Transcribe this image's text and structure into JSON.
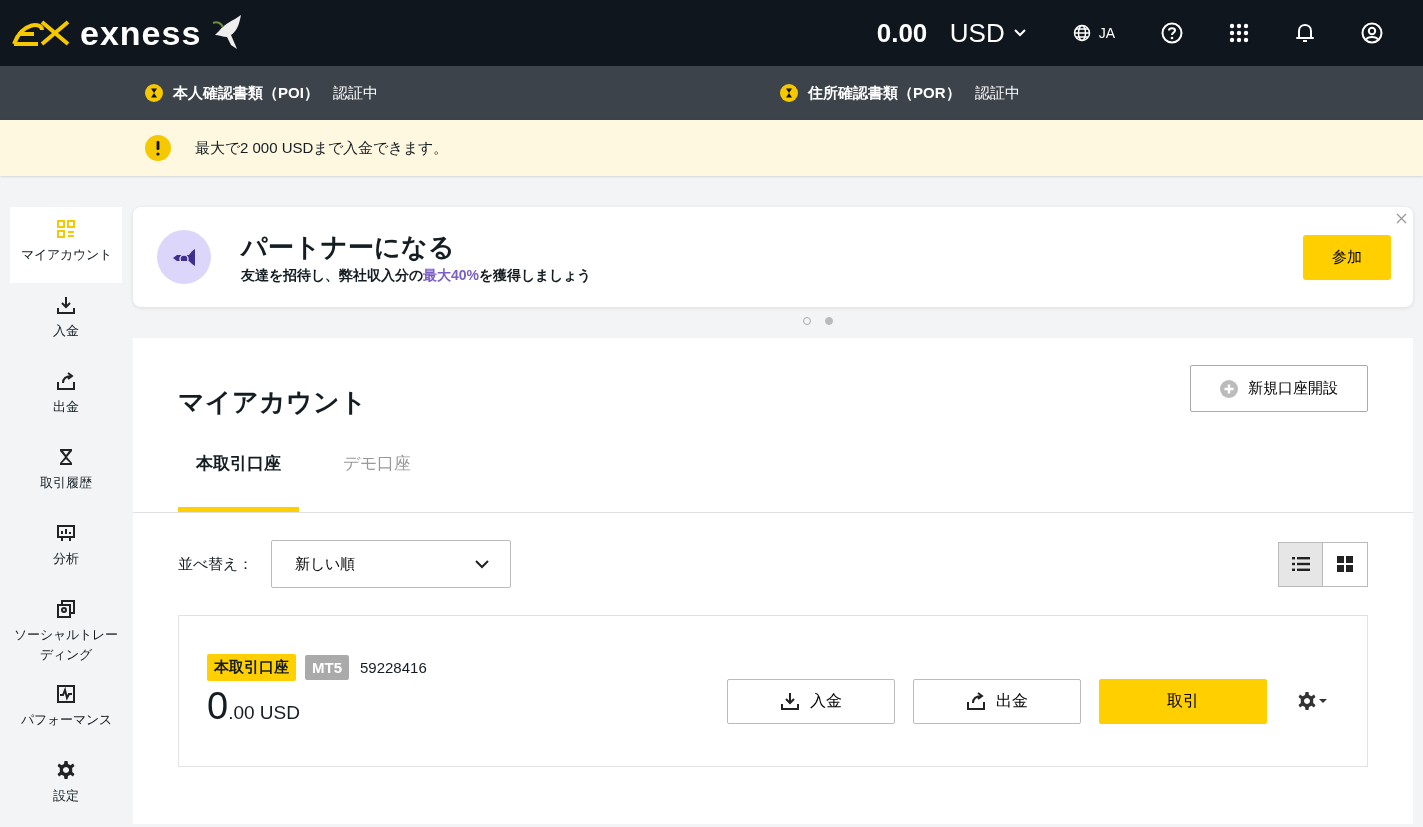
{
  "header": {
    "logo": "exness",
    "balance": "0.00",
    "currency": "USD",
    "language": "JA"
  },
  "verification": [
    {
      "label": "本人確認書類（POI）",
      "status": "認証中"
    },
    {
      "label": "住所確認書類（POR）",
      "status": "認証中"
    }
  ],
  "notice": {
    "text": "最大で2 000 USDまで入金できます。"
  },
  "sidebar": {
    "items": [
      {
        "label": "マイアカウント",
        "kind": "dashboard",
        "selected": true
      },
      {
        "label": "入金",
        "kind": "deposit",
        "selected": false
      },
      {
        "label": "出金",
        "kind": "withdraw",
        "selected": false
      },
      {
        "label": "取引履歴",
        "kind": "history",
        "selected": false
      },
      {
        "label": "分析",
        "kind": "analytics",
        "selected": false
      },
      {
        "label": "ソーシャルトレーディング",
        "kind": "social",
        "selected": false
      },
      {
        "label": "パフォーマンス",
        "kind": "performance",
        "selected": false
      },
      {
        "label": "設定",
        "kind": "settings",
        "selected": false
      }
    ]
  },
  "promo": {
    "title": "パートナーになる",
    "subtitle_before": "友達を招待し、弊社収入分の",
    "subtitle_highlight": "最大40%",
    "subtitle_after": "を獲得しましょう",
    "button": "参加",
    "dots": [
      {
        "selected": false
      },
      {
        "selected": true
      }
    ]
  },
  "accounts": {
    "title": "マイアカウント",
    "new_account_button": "新規口座開設",
    "tabs": [
      {
        "label": "本取引口座",
        "selected": true
      },
      {
        "label": "デモ口座",
        "selected": false
      }
    ],
    "sort": {
      "label": "並べ替え：",
      "value": "新しい順"
    },
    "views": [
      {
        "kind": "list",
        "selected": true
      },
      {
        "kind": "grid",
        "selected": false
      }
    ],
    "card": {
      "type": "本取引口座",
      "platform": "MT5",
      "number": "59228416",
      "balance_whole": "0",
      "balance_fraction": ".00 USD",
      "buttons": [
        {
          "label": "入金",
          "kind": "deposit"
        },
        {
          "label": "出金",
          "kind": "withdraw"
        },
        {
          "label": "取引",
          "kind": "trade"
        }
      ]
    }
  }
}
